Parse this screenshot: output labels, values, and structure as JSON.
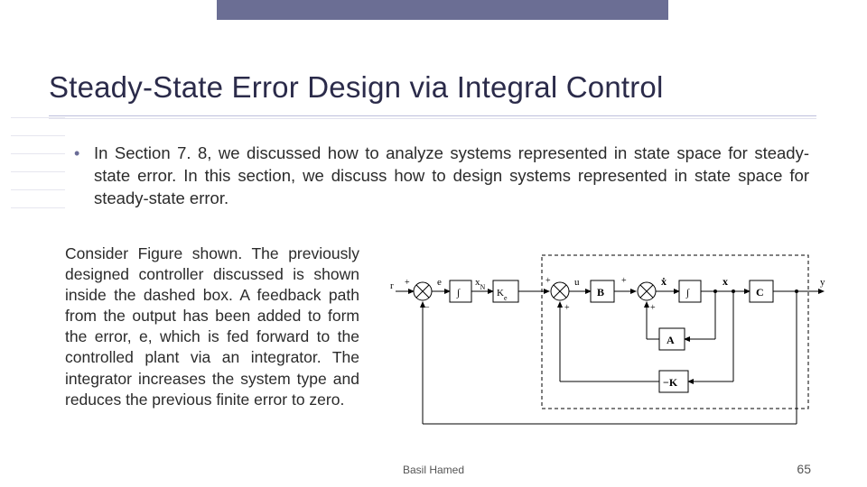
{
  "title": "Steady-State Error Design via Integral Control",
  "bullet": "In Section 7. 8, we discussed how to analyze systems represented in state space for steady-state error. In this section, we discuss how to design systems represented in state space for steady-state error.",
  "body": "Consider Figure shown. The previously designed controller discussed is shown inside the dashed box. A feedback path from the output has been added to form the error, e, which is fed forward to the controlled plant via an integrator. The integrator increases the system type and reduces the previous finite error to zero.",
  "diagram": {
    "input": "r",
    "error": "e",
    "int1": "∫",
    "xN": "x_N",
    "Ke": "K_e",
    "sum2": "u",
    "B": "B",
    "xdot": "ẋ",
    "int2": "∫",
    "x": "x",
    "C": "C",
    "y": "y",
    "A": "A",
    "K": "−K",
    "plus": "+",
    "minus": "−"
  },
  "footer": {
    "author": "Basil Hamed",
    "page": "65"
  }
}
